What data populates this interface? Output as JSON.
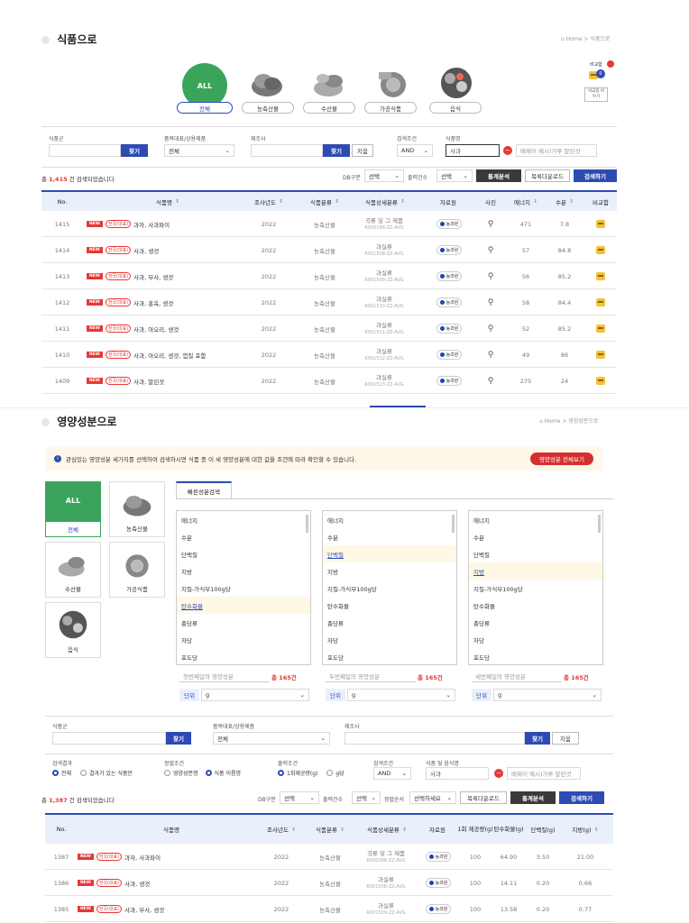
{
  "food": {
    "title": "식품으로",
    "breadcrumb": "Home > 식품으로",
    "compare_label": "비교함",
    "compare_count": "0",
    "compare_reset": "비교함 비우기",
    "categories": [
      {
        "label": "전체",
        "icon": "all-icon",
        "icon_text": "ALL"
      },
      {
        "label": "농축산물",
        "icon": "meat-icon"
      },
      {
        "label": "수산물",
        "icon": "seafood-icon"
      },
      {
        "label": "가공식품",
        "icon": "processed-food-icon"
      },
      {
        "label": "음식",
        "icon": "dish-icon"
      }
    ],
    "filters": {
      "food_group_label": "식품군",
      "find_btn": "찾기",
      "rep_label": "품목대표/상용제품",
      "rep_value": "전체",
      "maker_label": "제조사",
      "find_btn2": "찾기",
      "clear_btn": "지움",
      "cond_label": "검색조건",
      "cond_value": "AND",
      "name_label": "식품명",
      "name_value": "사과",
      "exclude_placeholder": "배제어 예시)가루 말린것"
    },
    "result_prefix": "총",
    "result_count": "1,415",
    "result_suffix": "건 검색되었습니다",
    "db_label": "DB구분",
    "db_value": "선택",
    "out_label": "출력건수",
    "out_value": "선택",
    "stats_btn": "통계분석",
    "download_btn": "목록다운로드",
    "search_btn": "검색하기",
    "columns": [
      "No.",
      "식품명",
      "조사년도",
      "식품분류",
      "식품상세분류",
      "자료원",
      "사진",
      "에너지",
      "수분",
      "비교함"
    ],
    "new_badge": "NEW",
    "rep_badge": "전국(대표)",
    "source_badge": "농과원",
    "rows": [
      {
        "no": "1415",
        "name": "과자, 사과파이",
        "year": "2022",
        "cat": "농축산물",
        "detail": "곡류 및 그 제품",
        "code": "R000188-ZZ-AVG",
        "energy": "471",
        "water": "7.8"
      },
      {
        "no": "1414",
        "name": "사과, 생것",
        "year": "2022",
        "cat": "농축산물",
        "detail": "과실류",
        "code": "R001508-ZZ-AVG",
        "energy": "57",
        "water": "84.8"
      },
      {
        "no": "1413",
        "name": "사과, 부사, 생것",
        "year": "2022",
        "cat": "농축산물",
        "detail": "과실류",
        "code": "R001509-ZZ-AVG",
        "energy": "56",
        "water": "85.2"
      },
      {
        "no": "1412",
        "name": "사과, 홍옥, 생것",
        "year": "2022",
        "cat": "농축산물",
        "detail": "과실류",
        "code": "R001510-ZZ-AVG",
        "energy": "58",
        "water": "84.4"
      },
      {
        "no": "1411",
        "name": "사과, 아오리, 생것",
        "year": "2022",
        "cat": "농축산물",
        "detail": "과실류",
        "code": "R001511-ZZ-AVG",
        "energy": "52",
        "water": "85.2"
      },
      {
        "no": "1410",
        "name": "사과, 아오리, 생것, 껍질 포함",
        "year": "2022",
        "cat": "농축산물",
        "detail": "과실류",
        "code": "R001512-ZZ-AVG",
        "energy": "49",
        "water": "86"
      },
      {
        "no": "1409",
        "name": "사과, 말린것",
        "year": "2022",
        "cat": "농축산물",
        "detail": "과실류",
        "code": "R001513-ZZ-AVG",
        "energy": "275",
        "water": "24"
      }
    ]
  },
  "nutrient": {
    "title": "영양성분으로",
    "breadcrumb": "Home > 영양성분으로",
    "notice": "관심있는 영양성분 세가지를 선택하여 검색하시면 식품 중 이 세 영양성분에 대한 값을 조건에 따라 확인할 수 있습니다.",
    "view_all_btn": "영양성분 전체보기",
    "tab_label": "빠른성분검색",
    "tiles": [
      {
        "label": "전체",
        "icon_text": "ALL"
      },
      {
        "label": "농축산물"
      },
      {
        "label": "수산물"
      },
      {
        "label": "가공식품"
      },
      {
        "label": "음식"
      }
    ],
    "nutrient_list": [
      "에너지",
      "수분",
      "단백질",
      "지방",
      "지질-가식부100g당",
      "탄수화물",
      "총당류",
      "자당",
      "포도당"
    ],
    "col_placeholders": [
      "첫번째일의 영양성분",
      "두번째일의 영양성분",
      "세번째일의 영양성분"
    ],
    "col_counts": [
      "총 165건",
      "총 165건",
      "총 165건"
    ],
    "unit_label": "단위",
    "unit_value": "g",
    "filters": {
      "food_group_label": "식품군",
      "find_btn": "찾기",
      "rep_label": "품목대표/상용제품",
      "rep_value": "전체",
      "maker_label": "제조사",
      "find_btn2": "찾기",
      "clear_btn": "지움",
      "result_label": "검색결과",
      "r_all": "전체",
      "r_some": "결과가 있는 식품만",
      "sort_label": "정렬조건",
      "s_nut": "영양성분명",
      "s_food": "식품 이름명",
      "out_label": "출력조건",
      "o_serving": "1회제공량(g)",
      "o_g": "g당",
      "cond_label": "검색조건",
      "cond_value": "AND",
      "name_label": "식품 및 음식명",
      "name_value": "사과",
      "exclude_placeholder": "배제어 예시)가루 말린것"
    },
    "result_prefix": "총",
    "result_count": "1,387",
    "result_suffix": "건 검색되었습니다",
    "db_label": "DB구분",
    "db_value": "선택",
    "out2_label": "출력건수",
    "out2_value": "선택",
    "order_label": "정렬순서",
    "order_value": "선택하세요",
    "download_btn": "목록다운로드",
    "stats_btn": "통계분석",
    "search_btn": "검색하기",
    "columns": [
      "No.",
      "식품명",
      "조사년도",
      "식품분류",
      "식품상세분류",
      "자료원",
      "1회 제공량(g)",
      "탄수화물(g)",
      "단백질(g)",
      "지방(g)"
    ],
    "rows": [
      {
        "no": "1387",
        "name": "과자, 사과파이",
        "year": "2022",
        "cat": "농축산물",
        "detail": "곡류 및 그 제품",
        "code": "R000188-ZZ-AVG",
        "serv": "100",
        "carb": "64.90",
        "prot": "3.50",
        "fat": "21.00"
      },
      {
        "no": "1386",
        "name": "사과, 생것",
        "year": "2022",
        "cat": "농축산물",
        "detail": "과실류",
        "code": "R001508-ZZ-AVG",
        "serv": "100",
        "carb": "14.11",
        "prot": "0.20",
        "fat": "0.66"
      },
      {
        "no": "1385",
        "name": "사과, 부사, 생것",
        "year": "2022",
        "cat": "농축산물",
        "detail": "과실류",
        "code": "R001509-ZZ-AVG",
        "serv": "100",
        "carb": "13.58",
        "prot": "0.20",
        "fat": "0.77"
      }
    ]
  }
}
